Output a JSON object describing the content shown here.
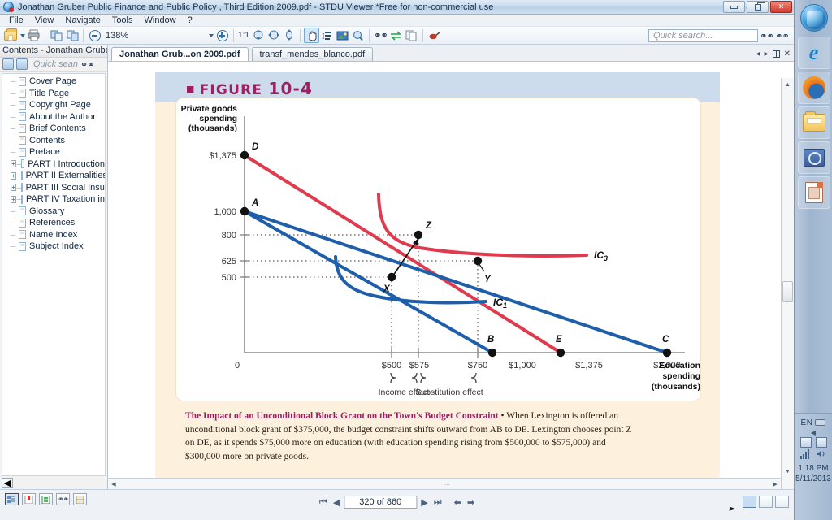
{
  "window": {
    "title": "Jonathan Gruber Public Finance and Public Policy , Third Edition   2009.pdf - STDU Viewer *Free for non-commercial use",
    "icon": "app-icon",
    "buttons": {
      "minimize": "minimize",
      "restore": "restore",
      "close": "✕"
    }
  },
  "menu": {
    "items": [
      "File",
      "View",
      "Navigate",
      "Tools",
      "Window",
      "?"
    ]
  },
  "toolbar": {
    "zoom_value": "138%",
    "fit_label": "1:1",
    "search_placeholder": "Quick search...",
    "icons": [
      "open-folder-icon",
      "dropdown-arrow-icon",
      "print-icon",
      "copy-page-icon",
      "paste-page-icon",
      "zoom-out-icon",
      "zoom-in-icon",
      "actual-size-icon",
      "fit-page-icon",
      "fit-width-icon",
      "fit-height-icon",
      "hand-tool-icon",
      "text-select-icon",
      "image-select-icon",
      "zoom-select-icon",
      "find-icon",
      "swap-icon",
      "copy-icon",
      "bookmark-icon"
    ]
  },
  "sidebar": {
    "header": "Contents - Jonathan Gruber",
    "search_placeholder": "Quick sean",
    "items": [
      {
        "label": "Cover Page",
        "expandable": false
      },
      {
        "label": "Title Page",
        "expandable": false
      },
      {
        "label": "Copyright Page",
        "expandable": false
      },
      {
        "label": "About the Author",
        "expandable": false
      },
      {
        "label": "Brief Contents",
        "expandable": false
      },
      {
        "label": "Contents",
        "expandable": false
      },
      {
        "label": "Preface",
        "expandable": false
      },
      {
        "label": "PART I Introduction",
        "expandable": true
      },
      {
        "label": "PART II Externalities",
        "expandable": true
      },
      {
        "label": "PART III Social Insur",
        "expandable": true
      },
      {
        "label": "PART IV Taxation in",
        "expandable": true
      },
      {
        "label": "Glossary",
        "expandable": false
      },
      {
        "label": "References",
        "expandable": false
      },
      {
        "label": "Name Index",
        "expandable": false
      },
      {
        "label": "Subject Index",
        "expandable": false
      }
    ]
  },
  "doc_tabs": [
    {
      "label": "Jonathan Grub...on   2009.pdf",
      "active": true
    },
    {
      "label": "transf_mendes_blanco.pdf",
      "active": false
    }
  ],
  "figure": {
    "bullet": "■",
    "label": "FIGURE",
    "number": "10-4",
    "caption_bold": "The Impact of an Unconditional Block Grant on the Town's Budget Constraint",
    "caption_rest": " • When Lexington is offered an unconditional block grant of $375,000, the budget constraint shifts outward from AB to DE. Lexington chooses point Z on DE, as it spends $75,000 more on education (with education spending rising from $500,000 to $575,000) and $300,000 more on private goods."
  },
  "chart_data": {
    "type": "line",
    "title": "FIGURE 10-4",
    "ylabel": "Private goods spending (thousands)",
    "xlabel": "Education spending (thousands)",
    "y_ticks": [
      "$1,375",
      "1,000",
      "800",
      "625",
      "500"
    ],
    "y_tick_values": [
      1375,
      1000,
      800,
      625,
      500
    ],
    "x_origin_label": "0",
    "x_ticks": [
      "$500",
      "$575",
      "$750",
      "$1,000",
      "$1,375",
      "$2,000"
    ],
    "x_tick_values": [
      500,
      575,
      750,
      1000,
      1375,
      2000
    ],
    "xlim": [
      0,
      2300
    ],
    "ylim": [
      0,
      1500
    ],
    "points": [
      {
        "id": "D",
        "label": "D",
        "x": 0,
        "y": 1375,
        "color": "#e03a4e"
      },
      {
        "id": "A",
        "label": "A",
        "x": 0,
        "y": 1000,
        "color": "#1f5fa9"
      },
      {
        "id": "Z",
        "label": "Z",
        "x": 575,
        "y": 800,
        "color": "#111111"
      },
      {
        "id": "Y",
        "label": "Y",
        "x": 750,
        "y": 625,
        "color": "#111111"
      },
      {
        "id": "X",
        "label": "X",
        "x": 500,
        "y": 500,
        "color": "#111111"
      },
      {
        "id": "B",
        "label": "B",
        "x": 1000,
        "y": 0,
        "color": "#1f5fa9"
      },
      {
        "id": "E",
        "label": "E",
        "x": 1375,
        "y": 0,
        "color": "#e03a4e"
      },
      {
        "id": "C",
        "label": "C",
        "x": 2000,
        "y": 0,
        "color": "#1f5fa9"
      }
    ],
    "series": [
      {
        "name": "AB budget constraint",
        "color": "#1f5fa9",
        "from": "A",
        "to": "B"
      },
      {
        "name": "AC budget constraint",
        "color": "#1f5fa9",
        "from": "A",
        "to": "C"
      },
      {
        "name": "DE budget constraint",
        "color": "#e03a4e",
        "from": "D",
        "to": "E"
      },
      {
        "name": "IC1 indifference curve",
        "color": "#1f5fa9",
        "label": "IC",
        "sub": "1"
      },
      {
        "name": "IC3 indifference curve",
        "color": "#e03a4e",
        "label": "IC",
        "sub": "3"
      }
    ],
    "annotations": [
      {
        "text": "Income effect",
        "type": "brace-label"
      },
      {
        "text": "Substitution effect",
        "type": "brace-label"
      }
    ],
    "grid": false,
    "legend": "inline-labels"
  },
  "statusbar": {
    "page_indicator": "320 of 860",
    "nav": [
      "first-page",
      "previous-page",
      "next-page",
      "last-page",
      "back",
      "forward"
    ],
    "left_icons": [
      "thumbnails-icon",
      "bookmark-icon",
      "page-layout-icon",
      "find-icon",
      "grid-icon"
    ]
  },
  "tray": {
    "language": "EN",
    "time": "1:18 PM",
    "date": "5/11/2013"
  },
  "dock": {
    "items": [
      "start-orb",
      "internet-explorer-icon",
      "firefox-icon",
      "file-explorer-icon",
      "search-icon",
      "document-icon"
    ]
  },
  "colors": {
    "red": "#e03a4e",
    "blue": "#1f5fa9",
    "magenta": "#9e1f63",
    "band": "#ccdcec",
    "page_cream": "#fdf1dd"
  }
}
